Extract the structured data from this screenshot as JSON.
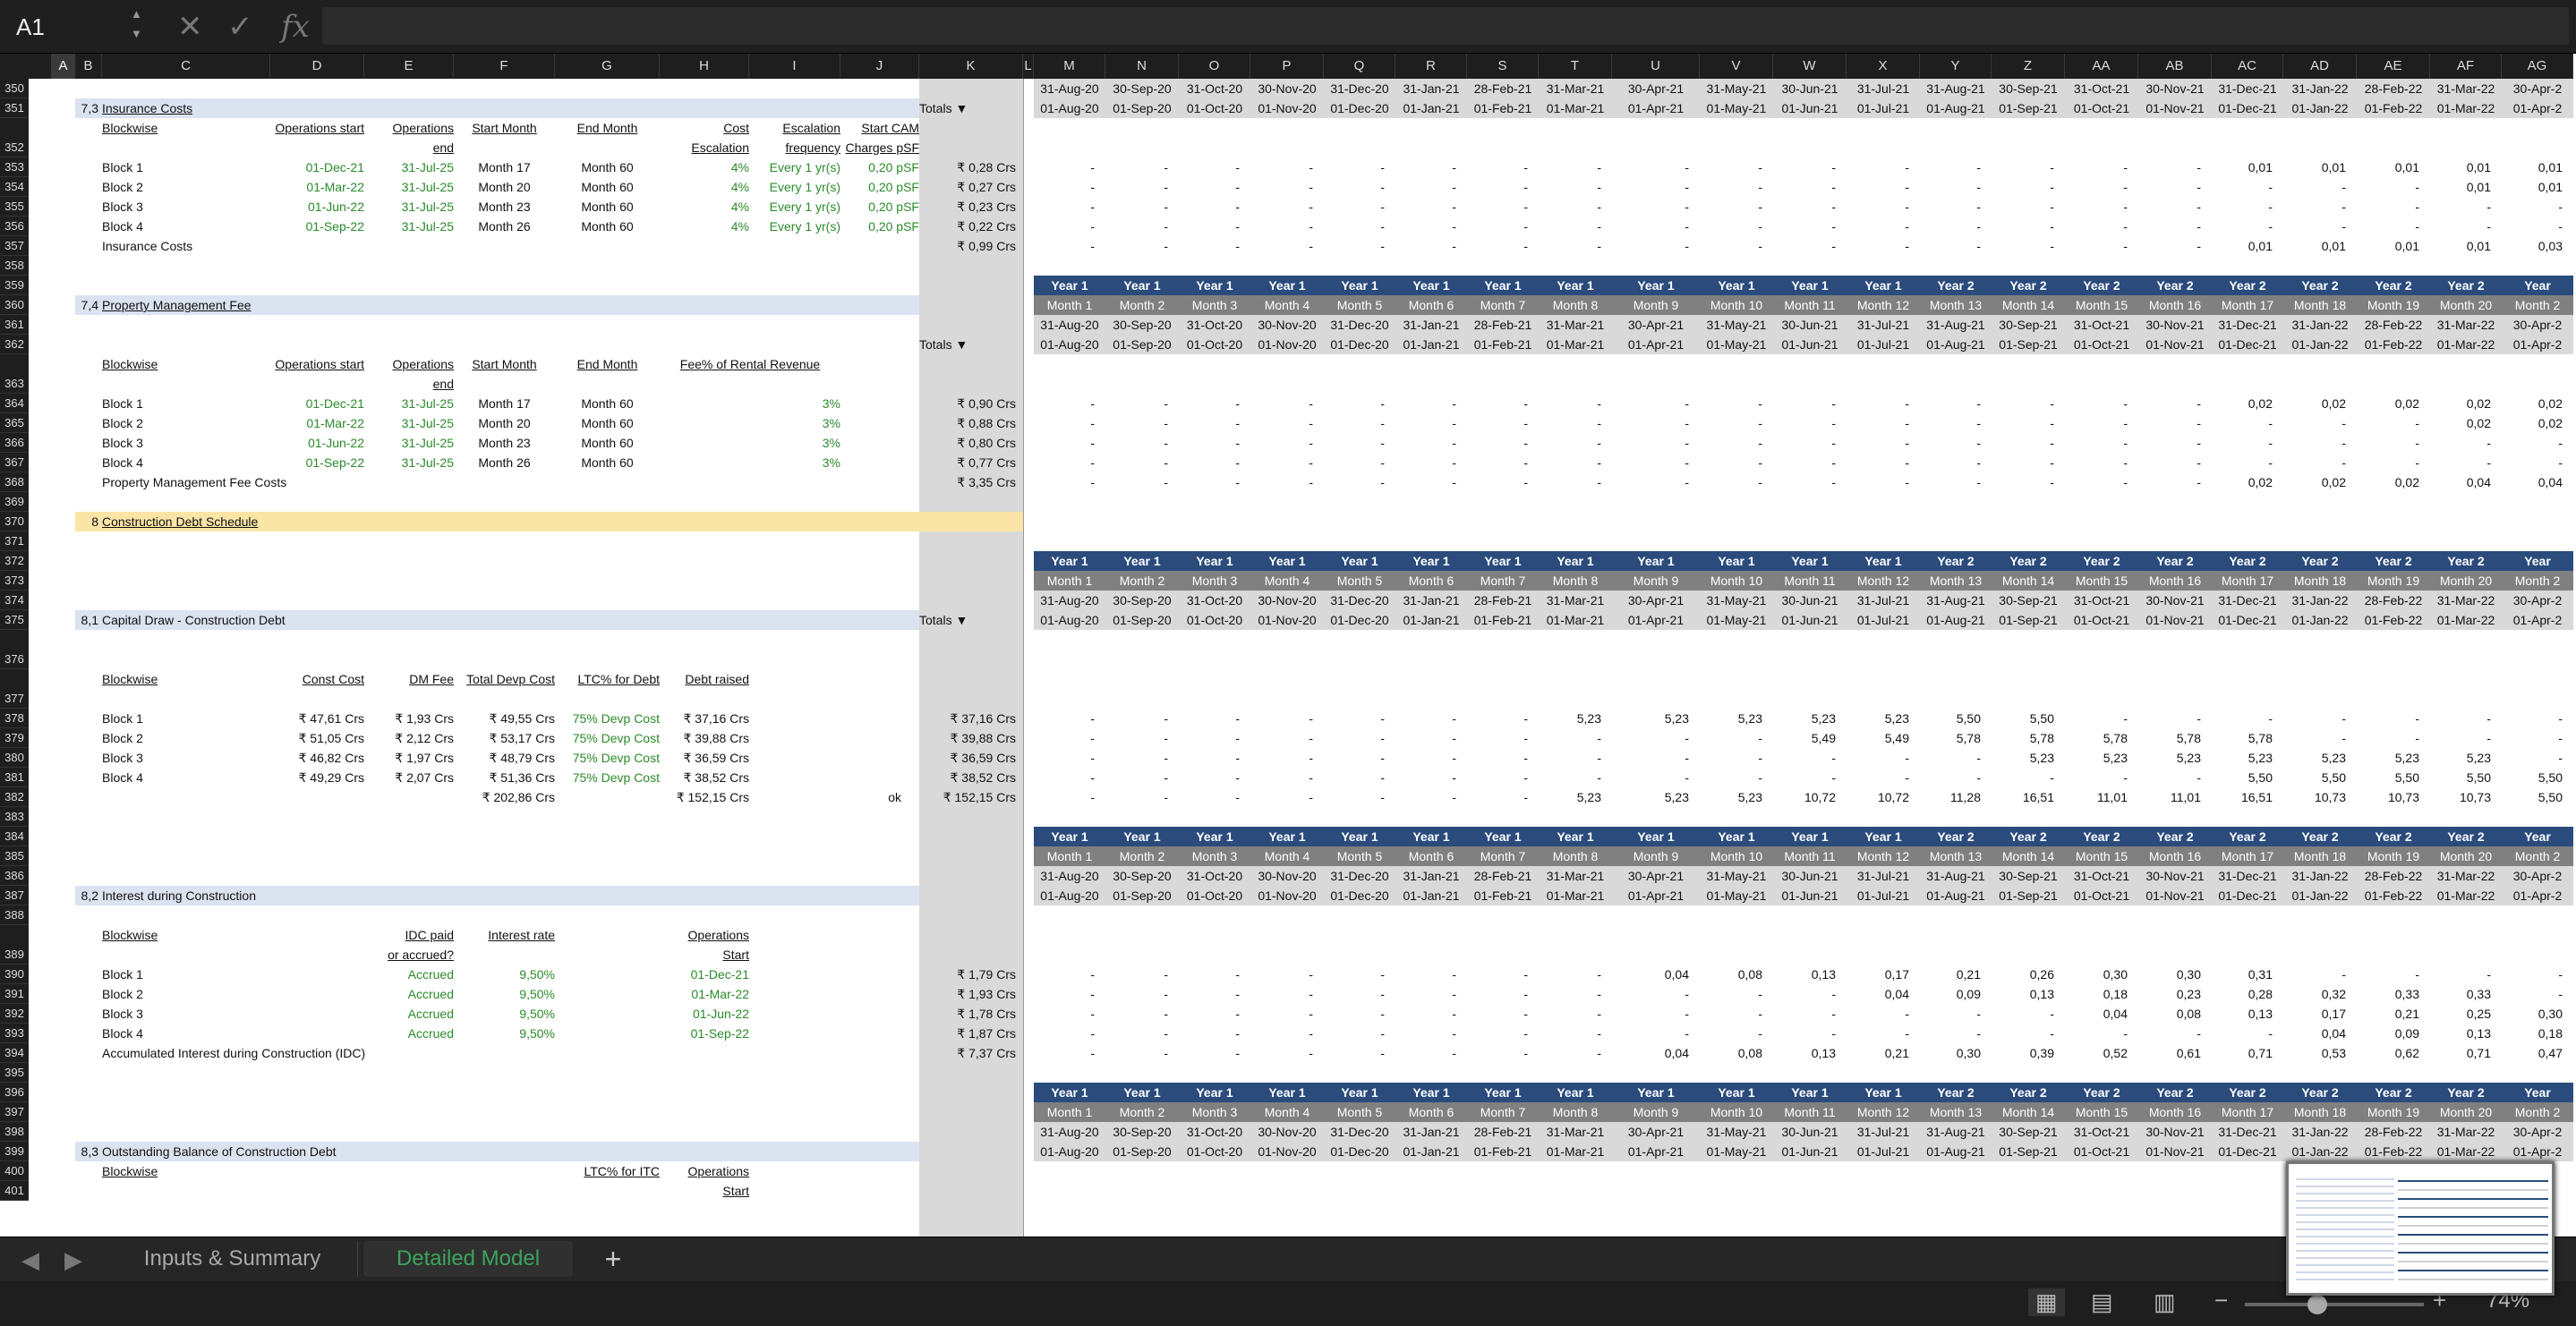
{
  "app": {
    "cell_ref": "A1",
    "fx_label": "fx",
    "cancel_icon": "✕",
    "confirm_icon": "✓"
  },
  "columns": [
    {
      "id": "A",
      "hl": true
    },
    {
      "id": "B"
    },
    {
      "id": "C"
    },
    {
      "id": "D"
    },
    {
      "id": "E"
    },
    {
      "id": "F"
    },
    {
      "id": "G"
    },
    {
      "id": "H"
    },
    {
      "id": "I"
    },
    {
      "id": "J"
    },
    {
      "id": "K"
    },
    {
      "id": "L"
    },
    {
      "id": "M"
    },
    {
      "id": "N"
    },
    {
      "id": "O"
    },
    {
      "id": "P"
    },
    {
      "id": "Q"
    },
    {
      "id": "R"
    },
    {
      "id": "S"
    },
    {
      "id": "T"
    },
    {
      "id": "U"
    },
    {
      "id": "V"
    },
    {
      "id": "W"
    },
    {
      "id": "X"
    },
    {
      "id": "Y"
    },
    {
      "id": "Z"
    },
    {
      "id": "AA"
    },
    {
      "id": "AB"
    },
    {
      "id": "AC"
    },
    {
      "id": "AD"
    },
    {
      "id": "AE"
    },
    {
      "id": "AF"
    },
    {
      "id": "AG"
    }
  ],
  "month_ends": [
    "31-Aug-20",
    "30-Sep-20",
    "31-Oct-20",
    "30-Nov-20",
    "31-Dec-20",
    "31-Jan-21",
    "28-Feb-21",
    "31-Mar-21",
    "30-Apr-21",
    "31-May-21",
    "30-Jun-21",
    "31-Jul-21",
    "31-Aug-21",
    "30-Sep-21",
    "31-Oct-21",
    "30-Nov-21",
    "31-Dec-21",
    "31-Jan-22",
    "28-Feb-22",
    "31-Mar-22",
    "30-Apr-2"
  ],
  "month_starts": [
    "01-Aug-20",
    "01-Sep-20",
    "01-Oct-20",
    "01-Nov-20",
    "01-Dec-20",
    "01-Jan-21",
    "01-Feb-21",
    "01-Mar-21",
    "01-Apr-21",
    "01-May-21",
    "01-Jun-21",
    "01-Jul-21",
    "01-Aug-21",
    "01-Sep-21",
    "01-Oct-21",
    "01-Nov-21",
    "01-Dec-21",
    "01-Jan-22",
    "01-Feb-22",
    "01-Mar-22",
    "01-Apr-2"
  ],
  "years": [
    "Year 1",
    "Year 1",
    "Year 1",
    "Year 1",
    "Year 1",
    "Year 1",
    "Year 1",
    "Year 1",
    "Year 1",
    "Year 1",
    "Year 1",
    "Year 1",
    "Year 2",
    "Year 2",
    "Year 2",
    "Year 2",
    "Year 2",
    "Year 2",
    "Year 2",
    "Year 2",
    "Year"
  ],
  "months": [
    "Month 1",
    "Month 2",
    "Month 3",
    "Month 4",
    "Month 5",
    "Month 6",
    "Month 7",
    "Month 8",
    "Month 9",
    "Month 10",
    "Month 11",
    "Month 12",
    "Month 13",
    "Month 14",
    "Month 15",
    "Month 16",
    "Month 17",
    "Month 18",
    "Month 19",
    "Month 20",
    "Month 2"
  ],
  "ts": {
    "insurance": [
      [
        "-",
        "-",
        "-",
        "-",
        "-",
        "-",
        "-",
        "-",
        "-",
        "-",
        "-",
        "-",
        "-",
        "-",
        "-",
        "-",
        "0,01",
        "0,01",
        "0,01",
        "0,01",
        "0,01"
      ],
      [
        "-",
        "-",
        "-",
        "-",
        "-",
        "-",
        "-",
        "-",
        "-",
        "-",
        "-",
        "-",
        "-",
        "-",
        "-",
        "-",
        "-",
        "-",
        "-",
        "0,01",
        "0,01"
      ],
      [
        "-",
        "-",
        "-",
        "-",
        "-",
        "-",
        "-",
        "-",
        "-",
        "-",
        "-",
        "-",
        "-",
        "-",
        "-",
        "-",
        "-",
        "-",
        "-",
        "-",
        "-"
      ],
      [
        "-",
        "-",
        "-",
        "-",
        "-",
        "-",
        "-",
        "-",
        "-",
        "-",
        "-",
        "-",
        "-",
        "-",
        "-",
        "-",
        "-",
        "-",
        "-",
        "-",
        "-"
      ],
      [
        "-",
        "-",
        "-",
        "-",
        "-",
        "-",
        "-",
        "-",
        "-",
        "-",
        "-",
        "-",
        "-",
        "-",
        "-",
        "-",
        "0,01",
        "0,01",
        "0,01",
        "0,01",
        "0,03"
      ]
    ],
    "pmf": [
      [
        "-",
        "-",
        "-",
        "-",
        "-",
        "-",
        "-",
        "-",
        "-",
        "-",
        "-",
        "-",
        "-",
        "-",
        "-",
        "-",
        "0,02",
        "0,02",
        "0,02",
        "0,02",
        "0,02"
      ],
      [
        "-",
        "-",
        "-",
        "-",
        "-",
        "-",
        "-",
        "-",
        "-",
        "-",
        "-",
        "-",
        "-",
        "-",
        "-",
        "-",
        "-",
        "-",
        "-",
        "0,02",
        "0,02"
      ],
      [
        "-",
        "-",
        "-",
        "-",
        "-",
        "-",
        "-",
        "-",
        "-",
        "-",
        "-",
        "-",
        "-",
        "-",
        "-",
        "-",
        "-",
        "-",
        "-",
        "-",
        "-"
      ],
      [
        "-",
        "-",
        "-",
        "-",
        "-",
        "-",
        "-",
        "-",
        "-",
        "-",
        "-",
        "-",
        "-",
        "-",
        "-",
        "-",
        "-",
        "-",
        "-",
        "-",
        "-"
      ],
      [
        "-",
        "-",
        "-",
        "-",
        "-",
        "-",
        "-",
        "-",
        "-",
        "-",
        "-",
        "-",
        "-",
        "-",
        "-",
        "-",
        "0,02",
        "0,02",
        "0,02",
        "0,04",
        "0,04"
      ]
    ],
    "capdraw": [
      [
        "-",
        "-",
        "-",
        "-",
        "-",
        "-",
        "-",
        "5,23",
        "5,23",
        "5,23",
        "5,23",
        "5,23",
        "5,50",
        "5,50",
        "-",
        "-",
        "-",
        "-",
        "-",
        "-",
        "-"
      ],
      [
        "-",
        "-",
        "-",
        "-",
        "-",
        "-",
        "-",
        "-",
        "-",
        "-",
        "5,49",
        "5,49",
        "5,78",
        "5,78",
        "5,78",
        "5,78",
        "5,78",
        "-",
        "-",
        "-",
        "-"
      ],
      [
        "-",
        "-",
        "-",
        "-",
        "-",
        "-",
        "-",
        "-",
        "-",
        "-",
        "-",
        "-",
        "-",
        "5,23",
        "5,23",
        "5,23",
        "5,23",
        "5,23",
        "5,23",
        "5,23",
        "-"
      ],
      [
        "-",
        "-",
        "-",
        "-",
        "-",
        "-",
        "-",
        "-",
        "-",
        "-",
        "-",
        "-",
        "-",
        "-",
        "-",
        "-",
        "5,50",
        "5,50",
        "5,50",
        "5,50",
        "5,50"
      ],
      [
        "-",
        "-",
        "-",
        "-",
        "-",
        "-",
        "-",
        "5,23",
        "5,23",
        "5,23",
        "10,72",
        "10,72",
        "11,28",
        "16,51",
        "11,01",
        "11,01",
        "16,51",
        "10,73",
        "10,73",
        "10,73",
        "5,50"
      ]
    ],
    "idc": [
      [
        "-",
        "-",
        "-",
        "-",
        "-",
        "-",
        "-",
        "-",
        "0,04",
        "0,08",
        "0,13",
        "0,17",
        "0,21",
        "0,26",
        "0,30",
        "0,30",
        "0,31",
        "-",
        "-",
        "-",
        "-"
      ],
      [
        "-",
        "-",
        "-",
        "-",
        "-",
        "-",
        "-",
        "-",
        "-",
        "-",
        "-",
        "0,04",
        "0,09",
        "0,13",
        "0,18",
        "0,23",
        "0,28",
        "0,32",
        "0,33",
        "0,33",
        "-"
      ],
      [
        "-",
        "-",
        "-",
        "-",
        "-",
        "-",
        "-",
        "-",
        "-",
        "-",
        "-",
        "-",
        "-",
        "-",
        "0,04",
        "0,08",
        "0,13",
        "0,17",
        "0,21",
        "0,25",
        "0,30"
      ],
      [
        "-",
        "-",
        "-",
        "-",
        "-",
        "-",
        "-",
        "-",
        "-",
        "-",
        "-",
        "-",
        "-",
        "-",
        "-",
        "-",
        "-",
        "0,04",
        "0,09",
        "0,13",
        "0,18"
      ],
      [
        "-",
        "-",
        "-",
        "-",
        "-",
        "-",
        "-",
        "-",
        "0,04",
        "0,08",
        "0,13",
        "0,21",
        "0,30",
        "0,39",
        "0,52",
        "0,61",
        "0,71",
        "0,53",
        "0,62",
        "0,71",
        "0,47"
      ]
    ]
  },
  "sections": {
    "ins_num": "7,3",
    "ins_title": "Insurance Costs",
    "pmf_num": "7,4",
    "pmf_title": "Property Management Fee",
    "cds_num": "8",
    "cds_title": "Construction Debt Schedule",
    "cap_num": "8,1",
    "cap_title": "Capital Draw - Construction Debt",
    "idc_num": "8,2",
    "idc_title": "Interest during Construction",
    "ob_num": "8,3",
    "ob_title": "Outstanding Balance of Construction Debt",
    "totals": "Totals ▼"
  },
  "ins": {
    "h_blockwise": "Blockwise",
    "h_opstart": "Operations start",
    "h_opend1": "Operations",
    "h_opend2": "end",
    "h_startm": "Start Month",
    "h_endm": "End Month",
    "h_cost1": "Cost",
    "h_cost2": "Escalation",
    "h_esc1": "Escalation",
    "h_esc2": "frequency",
    "h_cam1": "Start CAM",
    "h_cam2": "Charges pSF",
    "rows": [
      [
        "Block 1",
        "01-Dec-21",
        "31-Jul-25",
        "Month 17",
        "Month 60",
        "4%",
        "Every 1 yr(s)",
        "0,20 pSF",
        "₹ 0,28 Crs"
      ],
      [
        "Block 2",
        "01-Mar-22",
        "31-Jul-25",
        "Month 20",
        "Month 60",
        "4%",
        "Every 1 yr(s)",
        "0,20 pSF",
        "₹ 0,27 Crs"
      ],
      [
        "Block 3",
        "01-Jun-22",
        "31-Jul-25",
        "Month 23",
        "Month 60",
        "4%",
        "Every 1 yr(s)",
        "0,20 pSF",
        "₹ 0,23 Crs"
      ],
      [
        "Block 4",
        "01-Sep-22",
        "31-Jul-25",
        "Month 26",
        "Month 60",
        "4%",
        "Every 1 yr(s)",
        "0,20 pSF",
        "₹ 0,22 Crs"
      ]
    ],
    "total_label": "Insurance Costs",
    "total": "₹ 0,99 Crs"
  },
  "pmf": {
    "h_blockwise": "Blockwise",
    "h_opstart": "Operations start",
    "h_opend1": "Operations",
    "h_opend2": "end",
    "h_startm": "Start Month",
    "h_endm": "End Month",
    "h_fee": "Fee% of Rental Revenue",
    "rows": [
      [
        "Block 1",
        "01-Dec-21",
        "31-Jul-25",
        "Month 17",
        "Month 60",
        "3%",
        "₹ 0,90 Crs"
      ],
      [
        "Block 2",
        "01-Mar-22",
        "31-Jul-25",
        "Month 20",
        "Month 60",
        "3%",
        "₹ 0,88 Crs"
      ],
      [
        "Block 3",
        "01-Jun-22",
        "31-Jul-25",
        "Month 23",
        "Month 60",
        "3%",
        "₹ 0,80 Crs"
      ],
      [
        "Block 4",
        "01-Sep-22",
        "31-Jul-25",
        "Month 26",
        "Month 60",
        "3%",
        "₹ 0,77 Crs"
      ]
    ],
    "total_label": "Property Management Fee Costs",
    "total": "₹ 3,35 Crs"
  },
  "cap": {
    "h_blockwise": "Blockwise",
    "h_const": "Const Cost",
    "h_dm": "DM Fee",
    "h_tdc": "Total Devp Cost",
    "h_ltc": "LTC% for Debt",
    "h_debt": "Debt raised",
    "rows": [
      [
        "Block 1",
        "₹ 47,61 Crs",
        "₹ 1,93 Crs",
        "₹ 49,55 Crs",
        "75% Devp Cost",
        "₹ 37,16 Crs",
        "₹ 37,16 Crs"
      ],
      [
        "Block 2",
        "₹ 51,05 Crs",
        "₹ 2,12 Crs",
        "₹ 53,17 Crs",
        "75% Devp Cost",
        "₹ 39,88 Crs",
        "₹ 39,88 Crs"
      ],
      [
        "Block 3",
        "₹ 46,82 Crs",
        "₹ 1,97 Crs",
        "₹ 48,79 Crs",
        "75% Devp Cost",
        "₹ 36,59 Crs",
        "₹ 36,59 Crs"
      ],
      [
        "Block 4",
        "₹ 49,29 Crs",
        "₹ 2,07 Crs",
        "₹ 51,36 Crs",
        "75% Devp Cost",
        "₹ 38,52 Crs",
        "₹ 38,52 Crs"
      ]
    ],
    "tot_tdc": "₹ 202,86 Crs",
    "tot_debt": "₹ 152,15 Crs",
    "ok": "ok",
    "total": "₹ 152,15 Crs"
  },
  "idc": {
    "h_blockwise": "Blockwise",
    "h_paid1": "IDC paid",
    "h_paid2": "or accrued?",
    "h_rate": "Interest rate",
    "h_ops1": "Operations",
    "h_ops2": "Start",
    "rows": [
      [
        "Block 1",
        "Accrued",
        "9,50%",
        "01-Dec-21",
        "₹ 1,79 Crs"
      ],
      [
        "Block 2",
        "Accrued",
        "9,50%",
        "01-Mar-22",
        "₹ 1,93 Crs"
      ],
      [
        "Block 3",
        "Accrued",
        "9,50%",
        "01-Jun-22",
        "₹ 1,78 Crs"
      ],
      [
        "Block 4",
        "Accrued",
        "9,50%",
        "01-Sep-22",
        "₹ 1,87 Crs"
      ]
    ],
    "total_label": "Accumulated Interest during Construction (IDC)",
    "total": "₹ 7,37 Crs"
  },
  "ob": {
    "h_blockwise": "Blockwise",
    "h_ltc": "LTC% for ITC",
    "h_ops1": "Operations",
    "h_ops2": "Start"
  },
  "tabs": {
    "t1": "Inputs & Summary",
    "t2": "Detailed Model",
    "add": "+"
  },
  "status": {
    "zoom": "74%",
    "zoom_out": "−",
    "zoom_in": "+"
  }
}
